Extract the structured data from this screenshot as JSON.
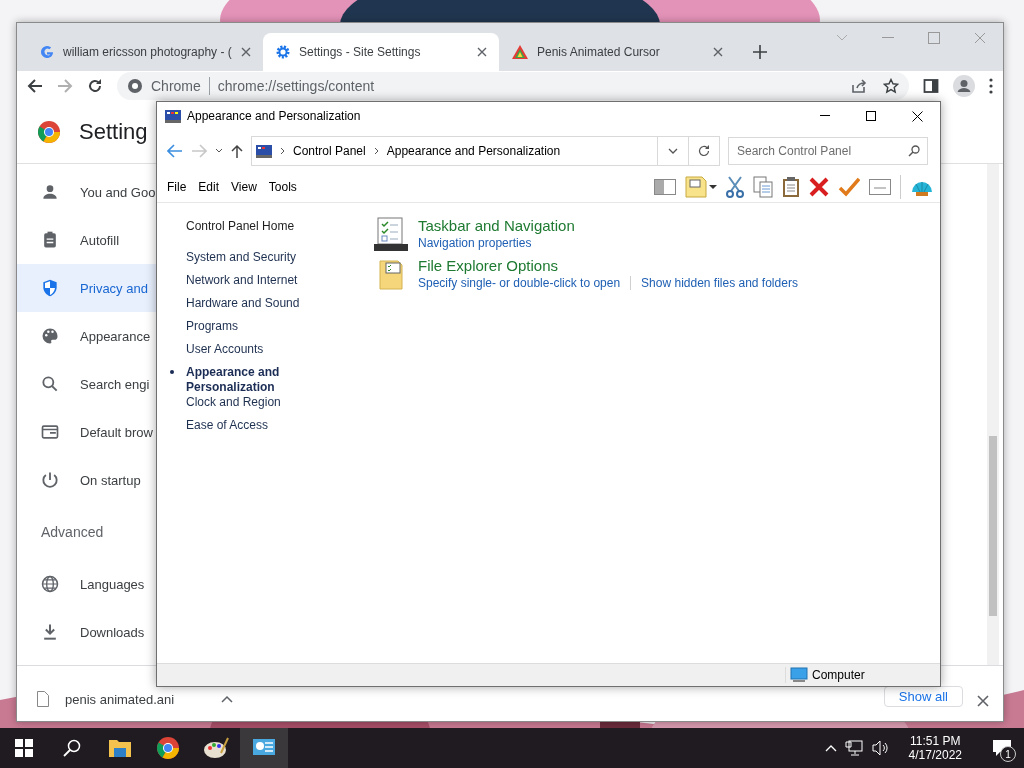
{
  "browser": {
    "tabs": [
      {
        "title": "william ericsson photography - (",
        "selected": false
      },
      {
        "title": "Settings - Site Settings",
        "selected": true
      },
      {
        "title": "Penis Animated Cursor",
        "selected": false
      }
    ],
    "chip": "Chrome",
    "url": "chrome://settings/content",
    "page_title": "Setting",
    "sidebar": [
      {
        "label": "You and Goo",
        "selected": false
      },
      {
        "label": "Autofill",
        "selected": false
      },
      {
        "label": "Privacy and",
        "selected": true
      },
      {
        "label": "Appearance",
        "selected": false
      },
      {
        "label": "Search engi",
        "selected": false
      },
      {
        "label": "Default brow",
        "selected": false
      },
      {
        "label": "On startup",
        "selected": false
      }
    ],
    "section": "Advanced",
    "advanced": [
      {
        "label": "Languages",
        "selected": false
      },
      {
        "label": "Downloads",
        "selected": false
      }
    ],
    "download": {
      "file": "penis animated.ani",
      "show_all": "Show all"
    }
  },
  "control_panel": {
    "title": "Appearance and Personalization",
    "breadcrumb": [
      "Control Panel",
      "Appearance and Personalization"
    ],
    "search": {
      "placeholder": "Search Control Panel"
    },
    "menu": [
      "File",
      "Edit",
      "View",
      "Tools"
    ],
    "home": "Control Panel Home",
    "nav": [
      {
        "label": "System and Security",
        "selected": false
      },
      {
        "label": "Network and Internet",
        "selected": false
      },
      {
        "label": "Hardware and Sound",
        "selected": false
      },
      {
        "label": "Programs",
        "selected": false
      },
      {
        "label": "User Accounts",
        "selected": false
      },
      {
        "label": "Appearance and Personalization",
        "selected": true
      },
      {
        "label": "Clock and Region",
        "selected": false
      },
      {
        "label": "Ease of Access",
        "selected": false
      }
    ],
    "categories": [
      {
        "title": "Taskbar and Navigation",
        "links": [
          "Navigation properties"
        ]
      },
      {
        "title": "File Explorer Options",
        "links": [
          "Specify single- or double-click to open",
          "Show hidden files and folders"
        ]
      }
    ],
    "status": "Computer"
  },
  "taskbar": {
    "time": "11:51 PM",
    "date": "4/17/2022",
    "notifications": "1"
  }
}
